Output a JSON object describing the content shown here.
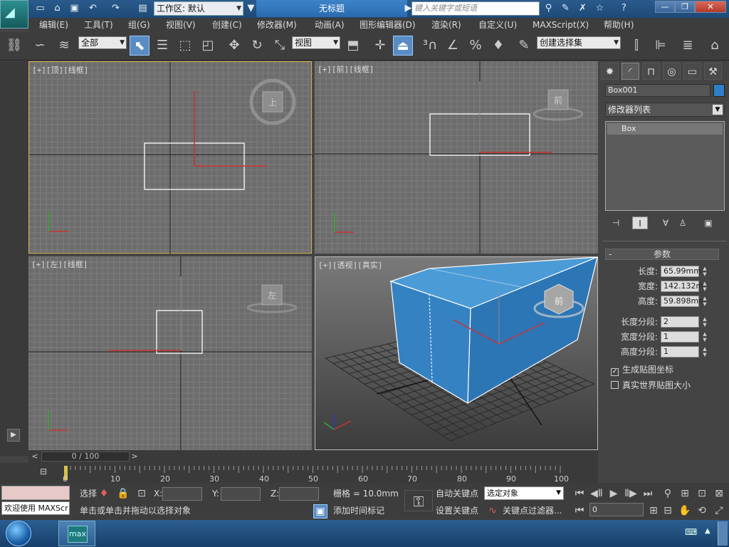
{
  "app": {
    "title": "无标题",
    "workspace_label": "工作区: 默认",
    "search_placeholder": "键入关键字或短语"
  },
  "quick_access_icons": [
    "new-file-icon",
    "open-folder-icon",
    "save-icon",
    "undo-icon",
    "redo-icon",
    "project-folder-icon"
  ],
  "title_right_icons": [
    "binoculars-icon",
    "wrench-icon",
    "star-icon",
    "help-icon"
  ],
  "window_controls": {
    "minimize": "—",
    "maximize": "❐",
    "close": "✕"
  },
  "menu": [
    "编辑(E)",
    "工具(T)",
    "组(G)",
    "视图(V)",
    "创建(C)",
    "修改器(M)",
    "动画(A)",
    "图形编辑器(D)",
    "渲染(R)",
    "自定义(U)",
    "MAXScript(X)",
    "帮助(H)"
  ],
  "toolbar": {
    "selection_filter": "全部",
    "ref_coord": "视图",
    "named_selection": "创建选择集"
  },
  "viewports": {
    "top": {
      "label": "[+][顶][线框]",
      "cube_face": "上"
    },
    "front": {
      "label": "[+][前][线框]",
      "cube_face": "前"
    },
    "left": {
      "label": "[+][左][线框]",
      "cube_face": "左"
    },
    "perspective": {
      "label": "[+][透视][真实]",
      "cube_face": "前"
    }
  },
  "axis_letters": {
    "x": "x",
    "y": "y",
    "z": "z"
  },
  "command_panel": {
    "object_name": "Box001",
    "object_color": "#2d7fc9",
    "modifier_list": "修改器列表",
    "stack_item": "Box",
    "params_title": "参数",
    "params": [
      {
        "label": "长度:",
        "value": "65.99mm"
      },
      {
        "label": "宽度:",
        "value": "142.132m"
      },
      {
        "label": "高度:",
        "value": "59.898mm"
      }
    ],
    "segments": [
      {
        "label": "长度分段:",
        "value": "2"
      },
      {
        "label": "宽度分段:",
        "value": "1"
      },
      {
        "label": "高度分段:",
        "value": "1"
      }
    ],
    "gen_mapping": "生成贴图坐标",
    "gen_mapping_checked": true,
    "real_world": "真实世界贴图大小",
    "real_world_checked": false
  },
  "timeline": {
    "slider": "0 / 100",
    "ticks": [
      "0",
      "10",
      "20",
      "30",
      "40",
      "50",
      "60",
      "70",
      "80",
      "90",
      "100"
    ]
  },
  "status": {
    "welcome": "欢迎使用 MAXScr",
    "select_label": "选择",
    "x_label": "X:",
    "y_label": "Y:",
    "z_label": "Z:",
    "grid": "栅格 = 10.0mm",
    "prompt": "单击或单击并拖动以选择对象",
    "add_time_tag": "添加时间标记",
    "auto_key": "自动关键点",
    "set_key": "设置关键点",
    "key_target": "选定对象",
    "key_filters": "关键点过滤器...",
    "frame": "0"
  }
}
